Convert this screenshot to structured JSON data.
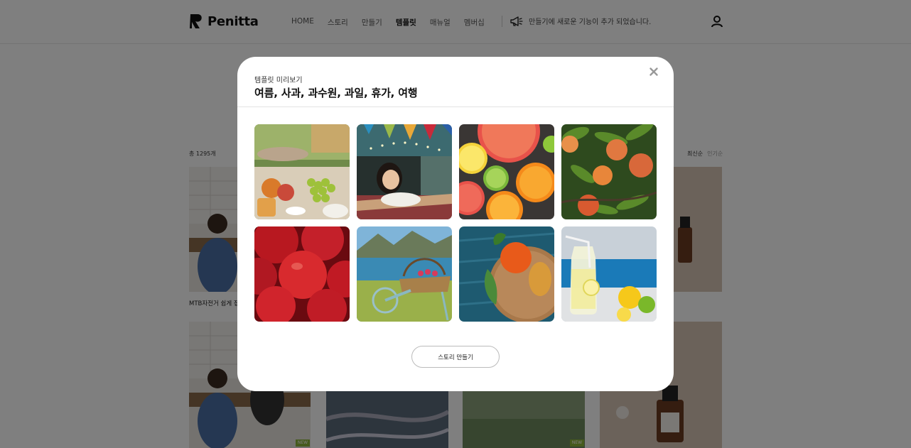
{
  "header": {
    "logo_text": "Penitta",
    "nav": [
      "HOME",
      "스토리",
      "만들기",
      "템플릿",
      "매뉴얼",
      "멤버십"
    ],
    "active_nav": "템플릿",
    "announcement": "만들기에 새로운 기능이 추가 되었습니다.",
    "announcement_icon": "megaphone-icon",
    "user_icon": "user-icon"
  },
  "listing": {
    "count": "총 1295개",
    "sort_latest": "최신순",
    "sort_popular": "인기순",
    "first_caption": "MTB자전거 쉽게 접",
    "new_badge": "NEW"
  },
  "modal": {
    "subtitle": "템플릿 미리보기",
    "title": "여름, 사과, 과수원, 과일, 휴가, 여행",
    "close_icon": "close-icon",
    "images": [
      "summer picnic table with fruits",
      "woman relaxing in camper van",
      "sliced citrus fruits",
      "peaches on tree",
      "red apples",
      "wooden cart with flower basket by lake",
      "orange and pear on wooden board",
      "lemonade jar with lemons"
    ],
    "make_button": "스토리 만들기"
  },
  "colors": {
    "overlay": "rgba(0,0,0,0.5)",
    "new_badge": "#8db43b"
  }
}
